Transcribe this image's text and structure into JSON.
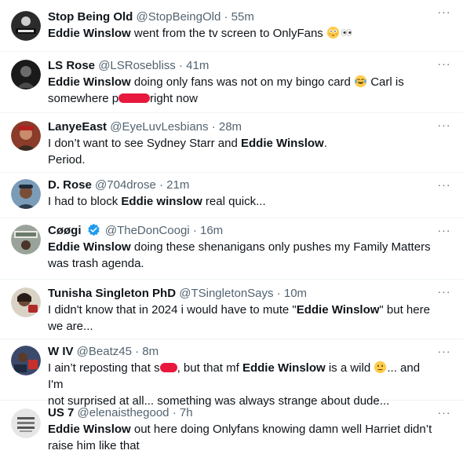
{
  "icons": {
    "more": "more-options-icon",
    "verified": "verified-badge-icon",
    "flushed": "flushed-face-emoji",
    "eyes": "eyes-emoji",
    "joy": "face-with-tears-of-joy-emoji",
    "meh": "neutral-face-emoji"
  },
  "colors": {
    "redaction": "#e8173e",
    "verified": "#1d9bf0",
    "secondary": "#536471"
  },
  "more_label": "···",
  "tweets": [
    {
      "name": "Stop Being Old",
      "handle": "@StopBeingOld",
      "time": "55m",
      "t": {
        "a": "Eddie Winslow",
        "b": " went from the tv screen to OnlyFans "
      }
    },
    {
      "name": "LS Rose",
      "handle": "@LSRosebliss",
      "time": "41m",
      "t": {
        "a": "Eddie Winslow",
        "b": " doing only fans was not on my bingo card ",
        "c": " Carl is somewhere p",
        "d": "right now"
      }
    },
    {
      "name": "LanyeEast",
      "handle": "@EyeLuvLesbians",
      "time": "28m",
      "t": {
        "a": "I don’t want to see Sydney Starr and ",
        "b": "Eddie Winslow",
        "c": ".",
        "d": "Period."
      }
    },
    {
      "name": "D. Rose",
      "handle": "@704drose",
      "time": "21m",
      "t": {
        "a": "I had to block ",
        "b": "Eddie winslow",
        "c": " real quick..."
      }
    },
    {
      "name": "Cøøgi",
      "handle": "@TheDonCoogi",
      "time": "16m",
      "t": {
        "a": "Eddie Winslow",
        "b": " doing these shenanigans only pushes my Family Matters",
        "c": "was trash agenda."
      }
    },
    {
      "name": "Tunisha Singleton PhD",
      "handle": "@TSingletonSays",
      "time": "10m",
      "t": {
        "a": "I didn't know that in 2024 i would have to mute \"",
        "b": "Eddie Winslow",
        "c": "\" but here",
        "d": "we are..."
      }
    },
    {
      "name": "W IV",
      "handle": "@Beatz45",
      "time": "8m",
      "t": {
        "a": "I ain’t reposting that s",
        "b": ", but that mf ",
        "c": "Eddie Winslow",
        "d": " is a wild ",
        "e": "... and I'm",
        "f": "not surprised at all... something was always strange about dude..."
      }
    },
    {
      "name": "US 7",
      "handle": "@elenaisthegood",
      "time": "7h",
      "t": {
        "a": "Eddie Winslow",
        "b": " out here doing Onlyfans knowing damn well Harriet didn’t",
        "c": "raise him like that"
      }
    }
  ]
}
